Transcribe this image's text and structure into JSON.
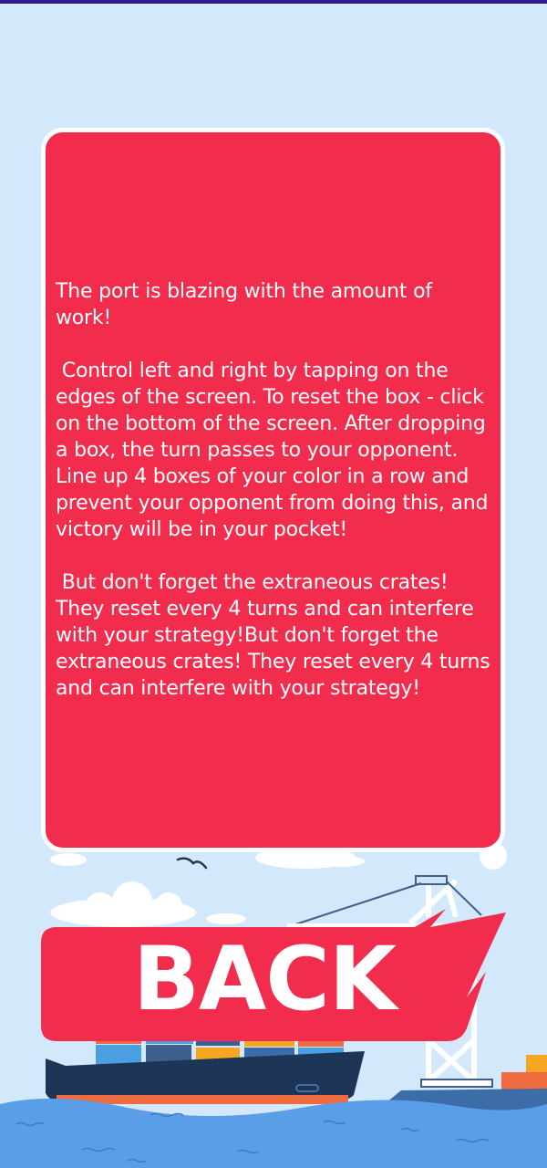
{
  "rules": {
    "text": "The port is blazing with the amount of work!\n\n Control left and right by tapping on the edges of the screen. To reset the box - click on the bottom of the screen. After dropping a box, the turn passes to your opponent. Line up 4 boxes of your color in a row and prevent your opponent from doing this, and victory will be in your pocket!\n\n But don't forget the extraneous crates! They reset every 4 turns and can interfere with your strategy!But don't forget the extraneous crates! They reset every 4 turns and can interfere with your strategy!"
  },
  "back_button": {
    "label": "BACK"
  },
  "colors": {
    "background": "#d3e8fb",
    "panel": "#f22c4d",
    "panel_border": "#ffffff",
    "text": "#ffffff",
    "ship_hull": "#1d3557",
    "crane": "#ffffff",
    "sea": "#5b9ee8"
  }
}
